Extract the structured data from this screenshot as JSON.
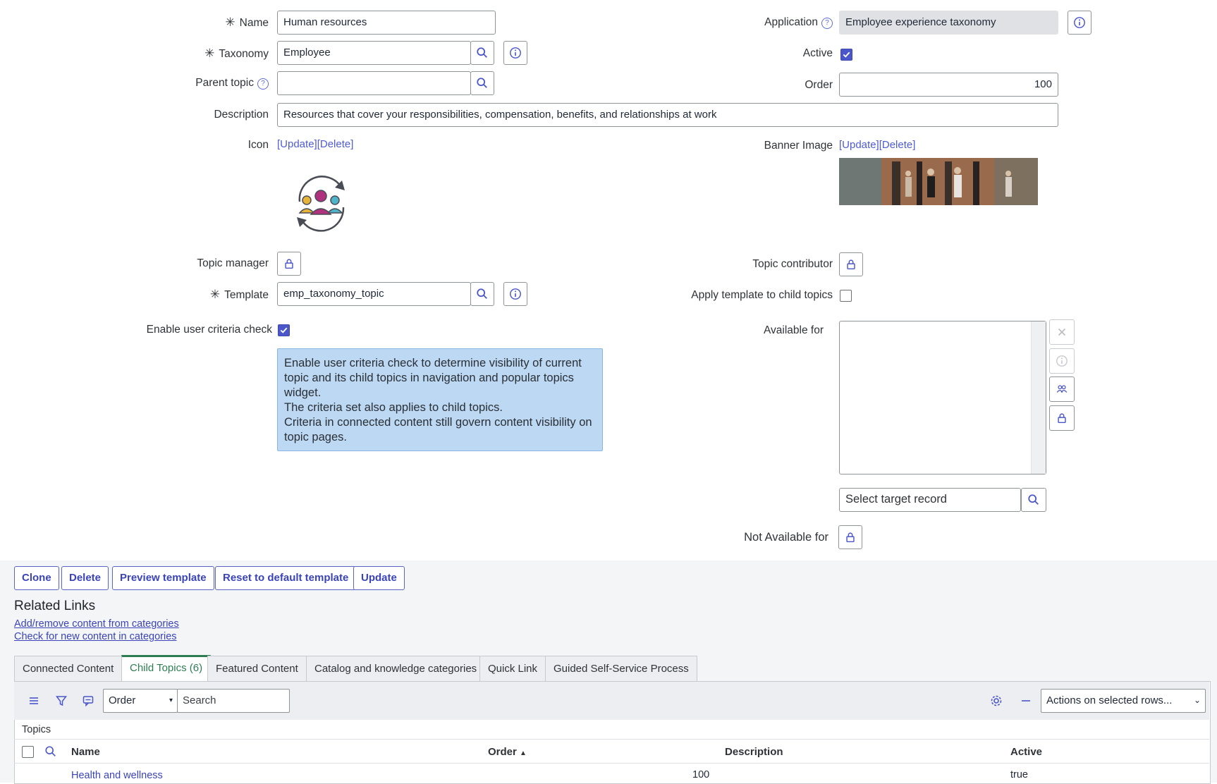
{
  "form": {
    "name": {
      "label": "Name",
      "value": "Human resources"
    },
    "taxonomy": {
      "label": "Taxonomy",
      "value": "Employee"
    },
    "parent_topic": {
      "label": "Parent topic",
      "value": ""
    },
    "description": {
      "label": "Description",
      "value": "Resources that cover your responsibilities, compensation, benefits, and relationships at work"
    },
    "icon": {
      "label": "Icon",
      "update": "[Update]",
      "delete": "[Delete]"
    },
    "topic_manager": {
      "label": "Topic manager"
    },
    "template": {
      "label": "Template",
      "value": "emp_taxonomy_topic"
    },
    "enable_user_criteria": {
      "label": "Enable user criteria check",
      "checked": true
    },
    "tooltip": {
      "line1": "Enable user criteria check to determine visibility of current topic and its child topics in navigation and popular topics widget.",
      "line2": "The criteria set also applies to child topics.",
      "line3": "Criteria in connected content still govern content visibility on topic pages."
    },
    "application": {
      "label": "Application",
      "value": "Employee experience taxonomy"
    },
    "active": {
      "label": "Active",
      "checked": true
    },
    "order": {
      "label": "Order",
      "value": "100"
    },
    "banner_image": {
      "label": "Banner Image",
      "update": "[Update]",
      "delete": "[Delete]"
    },
    "topic_contributor": {
      "label": "Topic contributor"
    },
    "apply_template": {
      "label": "Apply template to child topics",
      "checked": false
    },
    "available_for": {
      "label": "Available for",
      "select_placeholder": "Select target record"
    },
    "not_available_for": {
      "label": "Not Available for"
    }
  },
  "actions": {
    "clone": "Clone",
    "delete": "Delete",
    "preview": "Preview template",
    "reset": "Reset to default template",
    "update": "Update"
  },
  "related_links": {
    "title": "Related Links",
    "links": [
      "Add/remove content from categories",
      "Check for new content in categories"
    ]
  },
  "tabs": [
    {
      "label": "Connected Content",
      "active": false
    },
    {
      "label": "Child Topics (6)",
      "active": true
    },
    {
      "label": "Featured Content",
      "active": false
    },
    {
      "label": "Catalog and knowledge categories",
      "active": false
    },
    {
      "label": "Quick Link",
      "active": false
    },
    {
      "label": "Guided Self-Service Process",
      "active": false
    }
  ],
  "list": {
    "search_field": "Order",
    "search_placeholder": "Search",
    "actions_select": "Actions on selected rows...",
    "breadcrumb": "Topics",
    "columns": [
      "Name",
      "Order",
      "Description",
      "Active"
    ],
    "rows": [
      {
        "name": "Health and wellness",
        "order": "100",
        "description": "",
        "active": "true"
      }
    ]
  },
  "colors": {
    "accent": "#4b56c9",
    "active_tab": "#2e7d52",
    "tooltip_bg": "#bcd8f2"
  }
}
